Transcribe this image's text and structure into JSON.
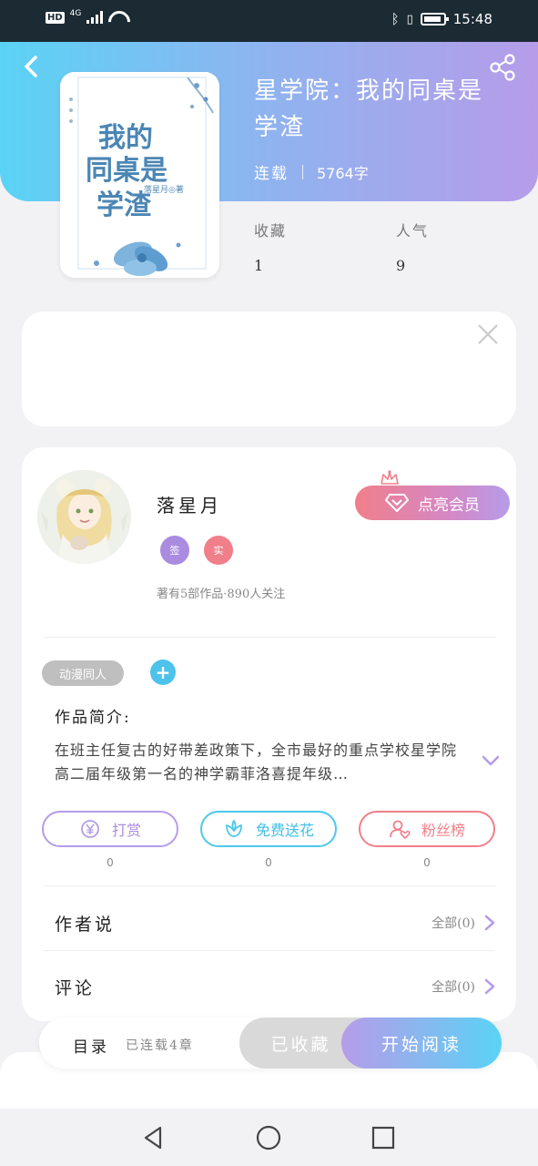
{
  "status_bar": {
    "hd": "HD",
    "network": "4G",
    "time": "15:48",
    "bluetooth_icon": "bluetooth-icon",
    "vibrate_icon": "vibrate-icon",
    "battery_icon": "battery-icon"
  },
  "header": {
    "back_icon": "chevron-left-icon",
    "share_icon": "share-icon",
    "gradient_start": "#5ad3f5",
    "gradient_end": "#b69ce9"
  },
  "book": {
    "title": "星学院：我的同桌是学渣",
    "status": "连载",
    "word_count": "5764字",
    "cover": {
      "title_line1": "我的",
      "title_line2": "同桌是",
      "title_line3": "学渣",
      "author": "落星月◎著"
    },
    "stats": [
      {
        "label": "收藏",
        "value": "1"
      },
      {
        "label": "人气",
        "value": "9"
      }
    ]
  },
  "ad": {
    "close_icon": "close-icon"
  },
  "author": {
    "name": "落星月",
    "badges": [
      "签",
      "实"
    ],
    "stats_text": "著有5部作品·890人关注",
    "vip_label": "点亮会员",
    "vip_icon": "diamond-icon",
    "crown_icon": "crown-icon"
  },
  "tags": {
    "items": [
      "动漫同人"
    ],
    "add_label": "+"
  },
  "intro": {
    "heading": "作品简介:",
    "text": "在班主任复古的好带差政策下，全市最好的重点学校星学院高二届年级第一名的神学霸菲洛喜提年级…"
  },
  "actions": [
    {
      "label": "打赏",
      "icon": "yen-coin-icon",
      "count": "0"
    },
    {
      "label": "免费送花",
      "icon": "flower-icon",
      "count": "0"
    },
    {
      "label": "粉丝榜",
      "icon": "fan-user-icon",
      "count": "0"
    }
  ],
  "rows": [
    {
      "title": "作者说",
      "right_text": "全部(0)"
    },
    {
      "title": "评论",
      "right_text": "全部(0)"
    }
  ],
  "bottom_bar": {
    "toc_label": "目录",
    "toc_count": "已连载4章",
    "collect_label": "已收藏",
    "read_label": "开始阅读"
  },
  "nav": {
    "back_icon": "nav-back-icon",
    "home_icon": "nav-home-icon",
    "recent_icon": "nav-recent-icon"
  }
}
